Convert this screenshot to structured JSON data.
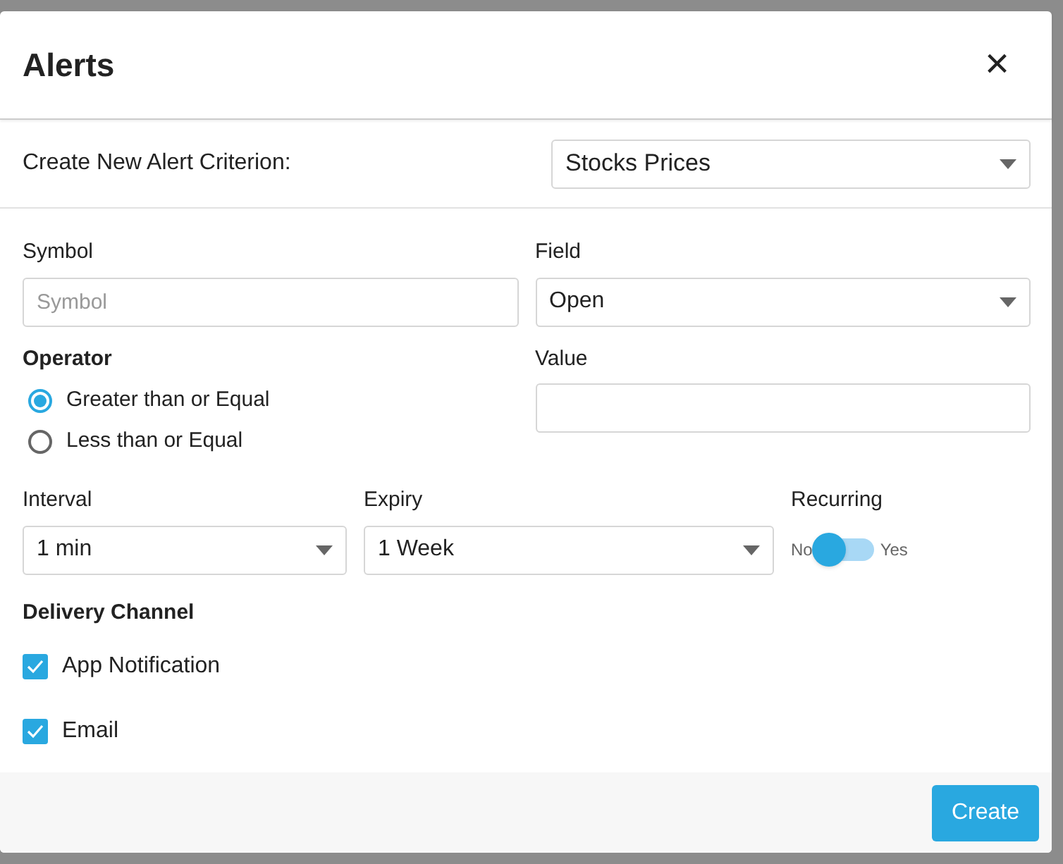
{
  "dialog": {
    "title": "Alerts",
    "close": "×",
    "criterion": {
      "label": "Create New Alert Criterion:",
      "value": "Stocks Prices"
    },
    "symbol": {
      "label": "Symbol",
      "placeholder": "Symbol"
    },
    "field": {
      "label": "Field",
      "value": "Open"
    },
    "operator": {
      "label": "Operator",
      "options": [
        {
          "label": "Greater than or Equal",
          "selected": true
        },
        {
          "label": "Less than or Equal",
          "selected": false
        }
      ]
    },
    "value": {
      "label": "Value"
    },
    "interval": {
      "label": "Interval",
      "value": "1 min"
    },
    "expiry": {
      "label": "Expiry",
      "value": "1 Week"
    },
    "recurring": {
      "label": "Recurring",
      "off_label": "No",
      "on_label": "Yes",
      "on": false
    },
    "delivery": {
      "label": "Delivery Channel",
      "channels": [
        {
          "label": "App Notification",
          "checked": true
        },
        {
          "label": "Email",
          "checked": true
        }
      ]
    },
    "buttons": [
      "Create"
    ]
  }
}
